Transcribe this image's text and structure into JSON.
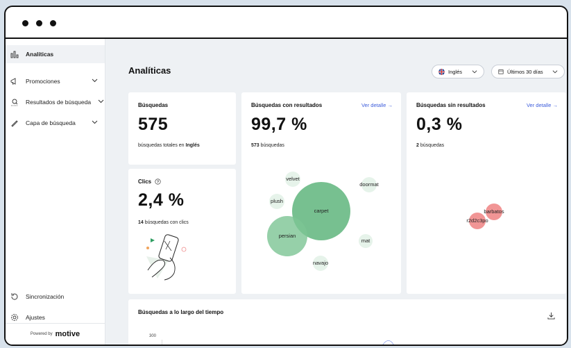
{
  "sidebar": {
    "items": [
      {
        "label": "Analíticas",
        "icon": "bar-chart-icon"
      },
      {
        "label": "Promociones",
        "icon": "megaphone-icon"
      },
      {
        "label": "Resultados de búsqueda",
        "icon": "search-results-icon"
      },
      {
        "label": "Capa de búsqueda",
        "icon": "pen-icon"
      }
    ],
    "bottom_items": [
      {
        "label": "Sincronización",
        "icon": "sync-icon"
      },
      {
        "label": "Ajustes",
        "icon": "gear-icon"
      }
    ],
    "powered_by": "Powered by",
    "brand": "motive"
  },
  "header": {
    "title": "Analíticas",
    "language_filter": "Inglés",
    "date_filter": "Últimos 30 días"
  },
  "cards": {
    "searches": {
      "title": "Búsquedas",
      "value": "575",
      "caption_prefix": "búsquedas totales en",
      "caption_lang": "Inglés"
    },
    "clicks": {
      "title": "Clics",
      "value": "2,4 %",
      "caption_count": "14",
      "caption_text": "búsquedas con clics"
    },
    "with_results": {
      "title": "Búsquedas con resultados",
      "value": "99,7 %",
      "caption_count": "573",
      "caption_text": "búsquedas",
      "link": "Ver detalle →",
      "bubbles": [
        "velvet",
        "doormat",
        "plush",
        "carpet",
        "persian",
        "mat",
        "navajo"
      ]
    },
    "no_results": {
      "title": "Búsquedas sin resultados",
      "value": "0,3 %",
      "caption_count": "2",
      "caption_text": "búsquedas",
      "link": "Ver detalle →",
      "bubbles": [
        "barbatos",
        "r2d2c3po"
      ]
    },
    "over_time": {
      "title": "Búsquedas a lo largo del tiempo",
      "y_tick": "300"
    }
  },
  "colors": {
    "accent": "#3b5bdb",
    "bubble_green": "#5fb57c",
    "bubble_light": "#e6f3ea",
    "bubble_red": "#ef8a8a"
  }
}
